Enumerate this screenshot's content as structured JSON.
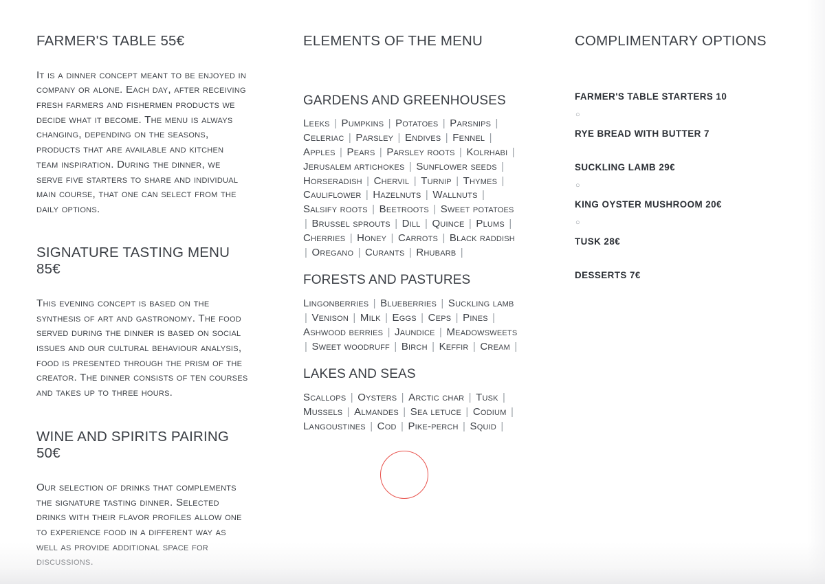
{
  "theme": {
    "background": "#ffffff",
    "heading_color": "#3a3e44",
    "body_color": "#3c4046",
    "separator_color": "#9aa0a6",
    "annotation_color": "#e8514b"
  },
  "left_column": {
    "blocks": [
      {
        "title": "FARMER'S TABLE 55€",
        "text": "It is a dinner concept meant to be enjoyed in company or alone. Each day, after receiving fresh farmers and fishermen products we decide what it become. The menu is always changing, depending on the seasons, products that are available and kitchen team inspiration. During the dinner, we serve five starters to share and individual main course, that one can select from the daily options."
      },
      {
        "title": "SIGNATURE TASTING MENU 85€",
        "text": "This evening concept is based on the synthesis of art and gastronomy. The food served during the dinner is based on social issues and our cultural behaviour analysis, food is presented through the prism of the creator. The dinner consists of ten courses and takes up to three hours."
      },
      {
        "title": "WINE AND SPIRITS PAIRING 50€",
        "text": "Our selection of drinks that complements the signature tasting dinner. Selected drinks with their flavor profiles  allow one to experience food in a different way as well as provide additional space for discussions."
      }
    ]
  },
  "middle_column": {
    "title": "ELEMENTS OF THE MENU",
    "sections": [
      {
        "title": "GARDENS AND GREENHOUSES",
        "items": [
          "Leeks",
          "Pumpkins",
          "Potatoes",
          "Parsnips",
          "Celeriac",
          "Parsley",
          "Endives",
          "Fennel",
          "Apples",
          "Pears",
          "Parsley roots",
          "Kolrhabi",
          "Jerusalem artichokes",
          "Sunflower seeds",
          "Horseradish",
          "Chervil",
          "Turnip",
          "Thymes",
          "Cauliflower",
          "Hazelnuts",
          "Wallnuts",
          "Salsify roots",
          "Beetroots",
          "Sweet potatoes",
          "Brussel sprouts",
          "Dill",
          "Quince",
          "Plums",
          "Cherries",
          "Honey",
          "Carrots",
          "Black raddish",
          "Oregano",
          "Curants",
          "Rhubarb"
        ]
      },
      {
        "title": "FORESTS AND PASTURES",
        "items": [
          "Lingonberries",
          "Blueberries",
          "Suckling lamb",
          "Venison",
          "Milk",
          "Eggs",
          "Ceps",
          "Pines",
          "Ashwood berries",
          "Jaundice",
          "Meadowsweets",
          "Sweet woodruff",
          "Birch",
          "Keffir",
          "Cream"
        ]
      },
      {
        "title": "LAKES AND SEAS",
        "items": [
          "Scallops",
          "Oysters",
          "Arctic char",
          "Tusk",
          "Mussels",
          "Almandes",
          "Sea letuce",
          "Codium",
          "Langoustines",
          "Cod",
          "Pike-perch",
          "Squid"
        ]
      }
    ],
    "separator": "|"
  },
  "right_column": {
    "title": "COMPLIMENTARY OPTIONS",
    "bullet": "○",
    "groups": [
      {
        "items": [
          "FARMER'S TABLE STARTERS 10",
          "RYE BREAD WITH BUTTER 7"
        ]
      },
      {
        "items": [
          "SUCKLING LAMB 29€",
          "KING OYSTER MUSHROOM 20€",
          "TUSK 28€"
        ]
      },
      {
        "items": [
          "DESSERTS 7€"
        ]
      }
    ]
  },
  "annotation": {
    "shape": "circle-outline",
    "color": "#e8514b"
  }
}
